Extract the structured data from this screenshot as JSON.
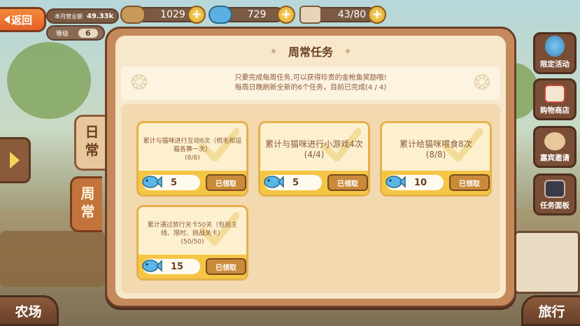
{
  "hud": {
    "back_label": "返回",
    "weekly_revenue_label": "本月营业额",
    "weekly_revenue_value": "49.33k",
    "level_label": "等级",
    "level_value": "6",
    "coins": "1029",
    "fish": "729",
    "cat_count": "43/80"
  },
  "side_tabs": {
    "daily": "日常",
    "weekly": "周常"
  },
  "right_menu": [
    {
      "label": "限定活动",
      "icon": "balloon-icon"
    },
    {
      "label": "购物商店",
      "icon": "shop-icon"
    },
    {
      "label": "嘉宾邀请",
      "icon": "hamster-icon"
    },
    {
      "label": "任务面板",
      "icon": "task-board-icon"
    }
  ],
  "bottom_nav": {
    "left": "农场",
    "right": "旅行"
  },
  "panel": {
    "title": "周常任务",
    "banner_line1": "只要完成每周任务,可以获得珍贵的金枪鱼奖励哦!",
    "banner_line2": "每周日晚刷新全新的6个任务，目前已完成(4 / 4)"
  },
  "tasks": [
    {
      "text": "累计与猫咪进行互动8次（梳毛和逗猫各算一次）",
      "progress": "(8/8)",
      "reward": "5",
      "button": "已领取"
    },
    {
      "text": "累计与猫咪进行小游戏4次",
      "progress": "(4/4)",
      "reward": "5",
      "button": "已领取"
    },
    {
      "text": "累计给猫咪喂食8次",
      "progress": "(8/8)",
      "reward": "10",
      "button": "已领取"
    },
    {
      "text": "累计通过旅行关卡50关（包括主线、限时、挑战关卡）",
      "progress": "(50/50)",
      "reward": "15",
      "button": "已领取"
    }
  ],
  "colors": {
    "panel_frame": "#c58a5c",
    "card_border": "#e6b04a",
    "card_footer": "#f5c645",
    "accent_orange": "#e4622a"
  }
}
